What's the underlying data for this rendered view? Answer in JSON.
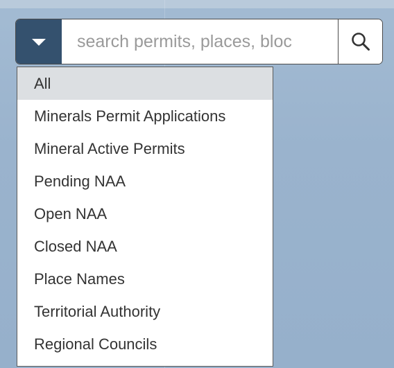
{
  "search": {
    "placeholder": "search permits, places, bloc",
    "value": ""
  },
  "icons": {
    "toggle": "chevron-down-icon",
    "search": "search-icon"
  },
  "colors": {
    "toggle_bg": "#34516e",
    "map_bg": "#9ab4ce",
    "selected_bg": "#dcdfe2"
  },
  "dropdown": {
    "selected": "All",
    "items": [
      {
        "label": "All"
      },
      {
        "label": "Minerals Permit Applications"
      },
      {
        "label": "Mineral Active Permits"
      },
      {
        "label": "Pending NAA"
      },
      {
        "label": "Open NAA"
      },
      {
        "label": "Closed NAA"
      },
      {
        "label": "Place Names"
      },
      {
        "label": "Territorial Authority"
      },
      {
        "label": "Regional Councils"
      }
    ]
  }
}
